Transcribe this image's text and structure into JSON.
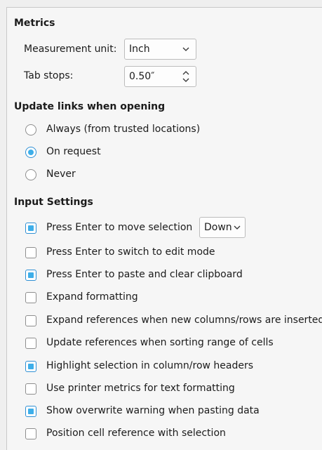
{
  "metrics": {
    "heading": "Metrics",
    "measurement_unit_label": "Measurement unit:",
    "measurement_unit_value": "Inch",
    "tab_stops_label": "Tab stops:",
    "tab_stops_value": "0.50″"
  },
  "update_links": {
    "heading": "Update links when opening",
    "options": [
      {
        "label": "Always (from trusted locations)",
        "selected": false
      },
      {
        "label": "On request",
        "selected": true
      },
      {
        "label": "Never",
        "selected": false
      }
    ]
  },
  "input_settings": {
    "heading": "Input Settings",
    "move_selection_direction": "Down",
    "options": [
      {
        "label": "Press Enter to move selection",
        "checked": true
      },
      {
        "label": "Press Enter to switch to edit mode",
        "checked": false
      },
      {
        "label": "Press Enter to paste and clear clipboard",
        "checked": true
      },
      {
        "label": "Expand formatting",
        "checked": false
      },
      {
        "label": "Expand references when new columns/rows are inserted",
        "checked": false
      },
      {
        "label": "Update references when sorting range of cells",
        "checked": false
      },
      {
        "label": "Highlight selection in column/row headers",
        "checked": true
      },
      {
        "label": "Use printer metrics for text formatting",
        "checked": false
      },
      {
        "label": "Show overwrite warning when pasting data",
        "checked": true
      },
      {
        "label": "Position cell reference with selection",
        "checked": false
      }
    ]
  },
  "colors": {
    "accent": "#3daee9",
    "panel_bg": "#f6f6f6"
  }
}
